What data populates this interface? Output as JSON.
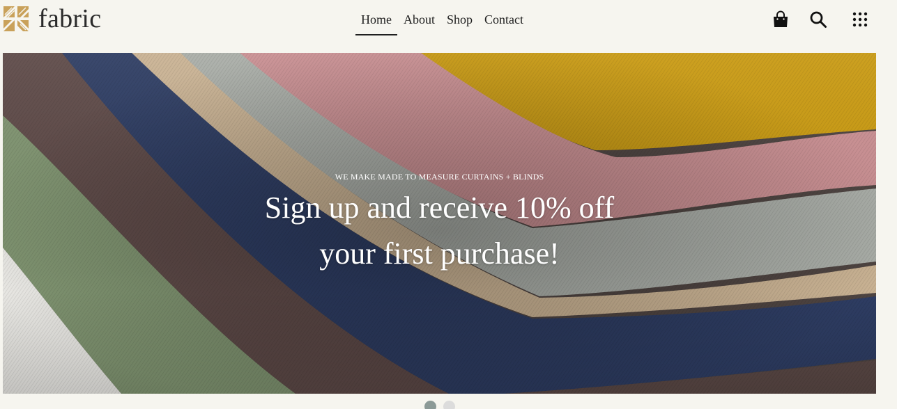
{
  "brand": {
    "name": "fabric",
    "logo_icon": "woven-fabric-logo-icon",
    "logo_color": "#c9a15a"
  },
  "nav": {
    "items": [
      {
        "label": "Home",
        "active": true
      },
      {
        "label": "About",
        "active": false
      },
      {
        "label": "Shop",
        "active": false
      },
      {
        "label": "Contact",
        "active": false
      }
    ]
  },
  "header_icons": [
    "shopping-bag-icon",
    "search-icon",
    "grid-menu-icon"
  ],
  "hero": {
    "kicker": "WE MAKE MADE TO MEASURE CURTAINS + BLINDS",
    "title_line1": "Sign up and receive 10% off",
    "title_line2": "your first purchase!"
  },
  "carousel": {
    "slides": 2,
    "current": 1,
    "active_color": "#8c9a97",
    "inactive_color": "#dcdcdc"
  },
  "colors": {
    "background": "#f6f5ef",
    "fabric_mustard": "#c99a12",
    "fabric_pink": "#c98f92",
    "fabric_grey": "#a9ada7",
    "fabric_beige": "#c9b293",
    "fabric_navy": "#2e3d63",
    "fabric_brown": "#5e4a48",
    "fabric_green": "#7f9370"
  }
}
